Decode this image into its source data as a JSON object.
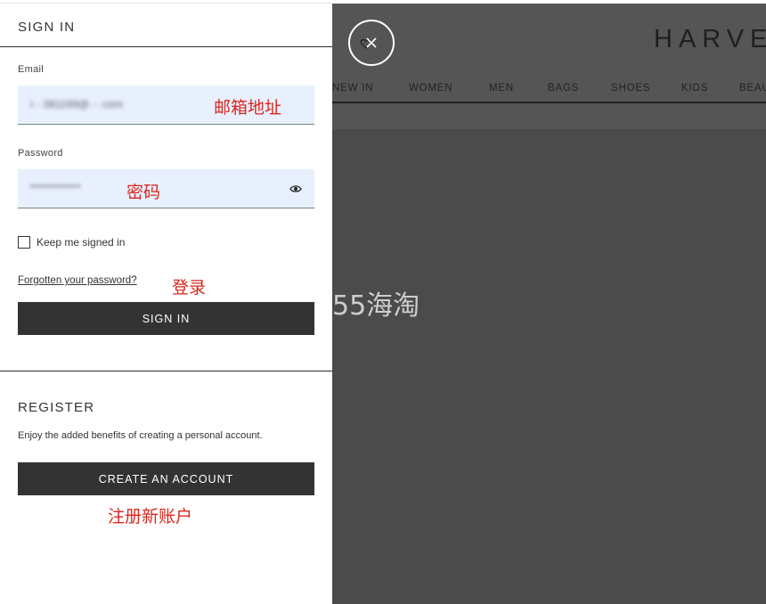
{
  "signin": {
    "heading": "SIGN IN",
    "email_label": "Email",
    "email_value": "i···381169@···.com",
    "password_label": "Password",
    "password_value": "•••••••••••",
    "keep_signed_in_label": "Keep me signed in",
    "forgot_password_link": "Forgotten your password?",
    "submit_label": "SIGN IN"
  },
  "register": {
    "heading": "REGISTER",
    "description": "Enjoy the added benefits of creating a personal account.",
    "create_account_label": "CREATE AN ACCOUNT"
  },
  "annotations": {
    "email_note": "邮箱地址",
    "password_note": "密码",
    "login_note": "登录",
    "register_note": "注册新账户"
  },
  "background_site": {
    "brand": "HARVEY",
    "nav": [
      "NEW IN",
      "WOMEN",
      "MEN",
      "BAGS",
      "SHOES",
      "KIDS",
      "BEAU"
    ]
  },
  "watermark": "55海淘",
  "icons": {
    "close": "close-icon",
    "wishlist": "heart-icon",
    "show_password": "eye-icon"
  },
  "colors": {
    "button_dark": "#333333",
    "overlay": "#4b4b4b",
    "input_bg": "#e8f0fe",
    "annotation_red": "#d9271f"
  }
}
